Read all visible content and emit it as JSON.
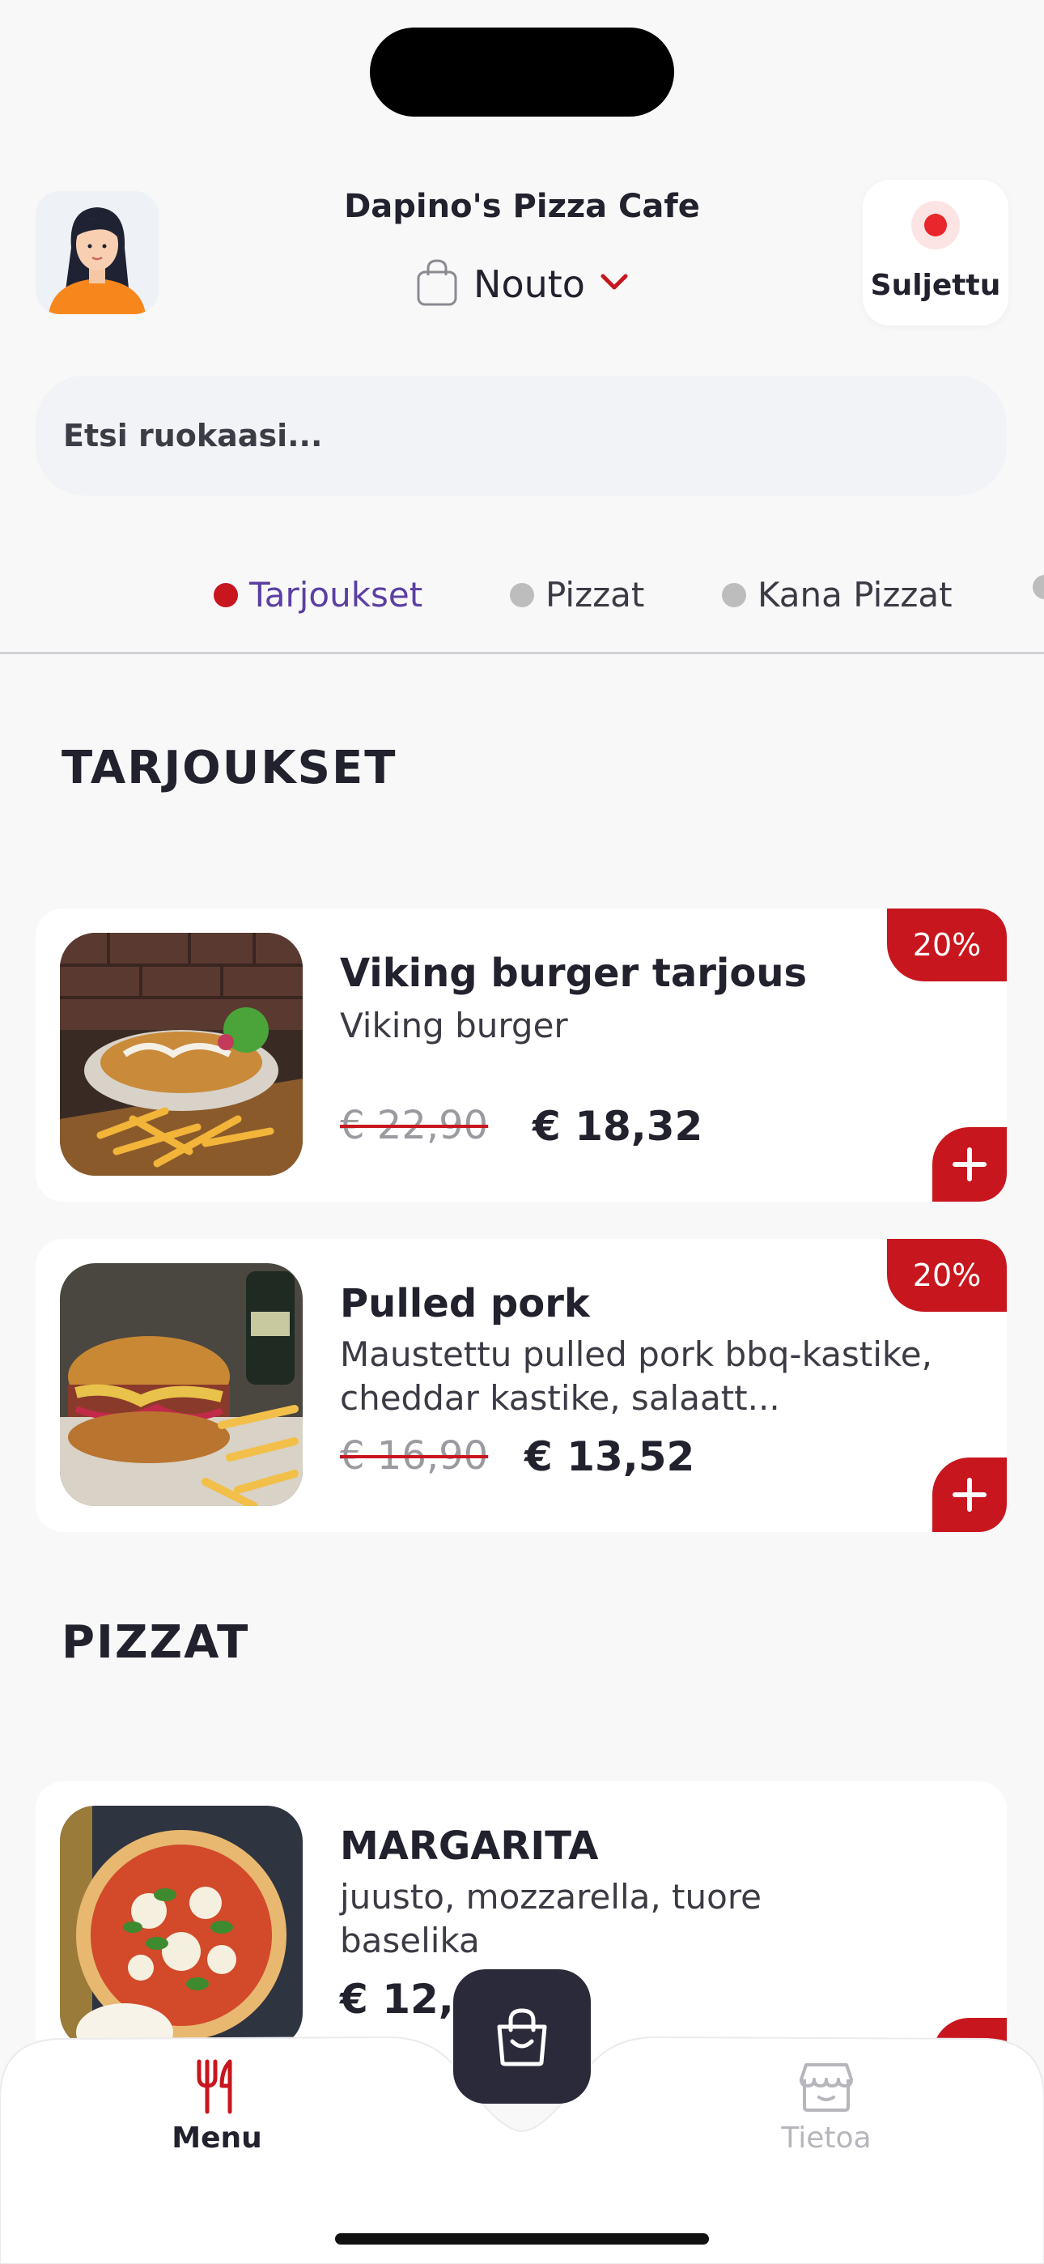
{
  "header": {
    "store_name": "Dapino's Pizza Cafe",
    "mode_label": "Nouto",
    "status_label": "Suljettu"
  },
  "search": {
    "placeholder": "Etsi ruokaasi..."
  },
  "category_tabs": [
    {
      "label": "Tarjoukset",
      "active": true
    },
    {
      "label": "Pizzat",
      "active": false
    },
    {
      "label": "Kana Pizzat",
      "active": false
    }
  ],
  "sections": {
    "offers_title": "TARJOUKSET",
    "pizzas_title": "PIZZAT"
  },
  "offers": [
    {
      "title": "Viking burger tarjous",
      "description": "Viking burger",
      "old_price": "€ 22,90",
      "new_price": "€ 18,32",
      "discount": "20%"
    },
    {
      "title": "Pulled pork",
      "description": "Maustettu pulled pork bbq-kastike, cheddar kastike, salaatt...",
      "old_price": "€ 16,90",
      "new_price": "€ 13,52",
      "discount": "20%"
    }
  ],
  "pizzas": [
    {
      "title": "MARGARITA",
      "description": "juusto, mozzarella, tuore baselika",
      "price": "€ 12,90"
    }
  ],
  "bottom_nav": {
    "menu_label": "Menu",
    "info_label": "Tietoa"
  },
  "colors": {
    "accent_red": "#c8161e",
    "active_tab": "#5b3fa3",
    "dark": "#22222e"
  }
}
